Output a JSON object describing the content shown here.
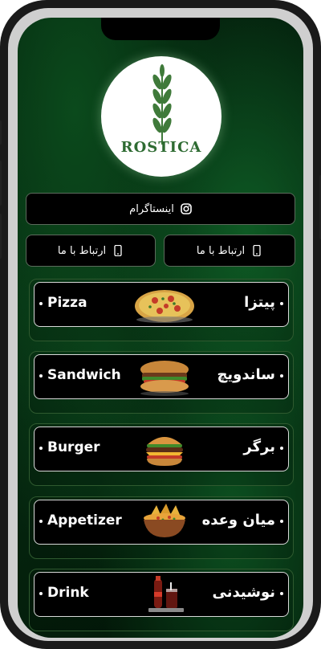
{
  "brand": {
    "logo_text": "ROSTICA"
  },
  "links": {
    "instagram_label": "اینستاگرام",
    "contact_left_label": "ارتباط با ما",
    "contact_right_label": "ارتباط با ما"
  },
  "menu": {
    "items": [
      {
        "en": "Pizza",
        "fa": "پیتزا",
        "icon": "pizza-image"
      },
      {
        "en": "Sandwich",
        "fa": "ساندویچ",
        "icon": "sandwich-image"
      },
      {
        "en": "Burger",
        "fa": "برگر",
        "icon": "burger-image"
      },
      {
        "en": "Appetizer",
        "fa": "میان وعده",
        "icon": "appetizer-image"
      },
      {
        "en": "Drink",
        "fa": "نوشیدنی",
        "icon": "drink-image"
      }
    ]
  },
  "colors": {
    "accent_green": "#2e6b32",
    "background_dark": "#04210d"
  }
}
